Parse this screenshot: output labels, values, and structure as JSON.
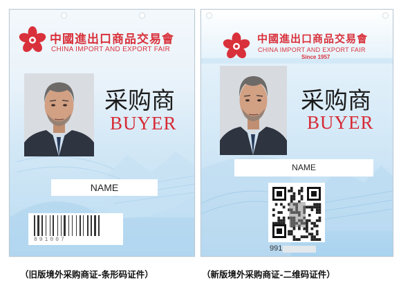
{
  "old_badge": {
    "fair_name_cn": "中國進出口商品交易會",
    "fair_name_en": "CHINA IMPORT AND EXPORT FAIR",
    "role_cn": "采购商",
    "role_en": "BUYER",
    "name_field": "NAME",
    "barcode_number": "891007",
    "code_type": "barcode"
  },
  "new_badge": {
    "fair_name_cn": "中國進出口商品交易會",
    "fair_name_en": "CHINA IMPORT AND EXPORT FAIR",
    "since": "Since 1957",
    "role_cn": "采购商",
    "role_en": "BUYER",
    "name_field": "NAME",
    "qr_number": "991",
    "code_type": "qr-code"
  },
  "captions": {
    "old": "（旧版境外采购商证-条形码证件）",
    "new": "（新版境外采购商证-二维码证件）"
  },
  "colors": {
    "brand_red": "#d9313b",
    "badge_blue": "#cfe6f6",
    "logo_icon": "canton-fair-flower-logo",
    "portrait": "man-in-suit-portrait"
  }
}
